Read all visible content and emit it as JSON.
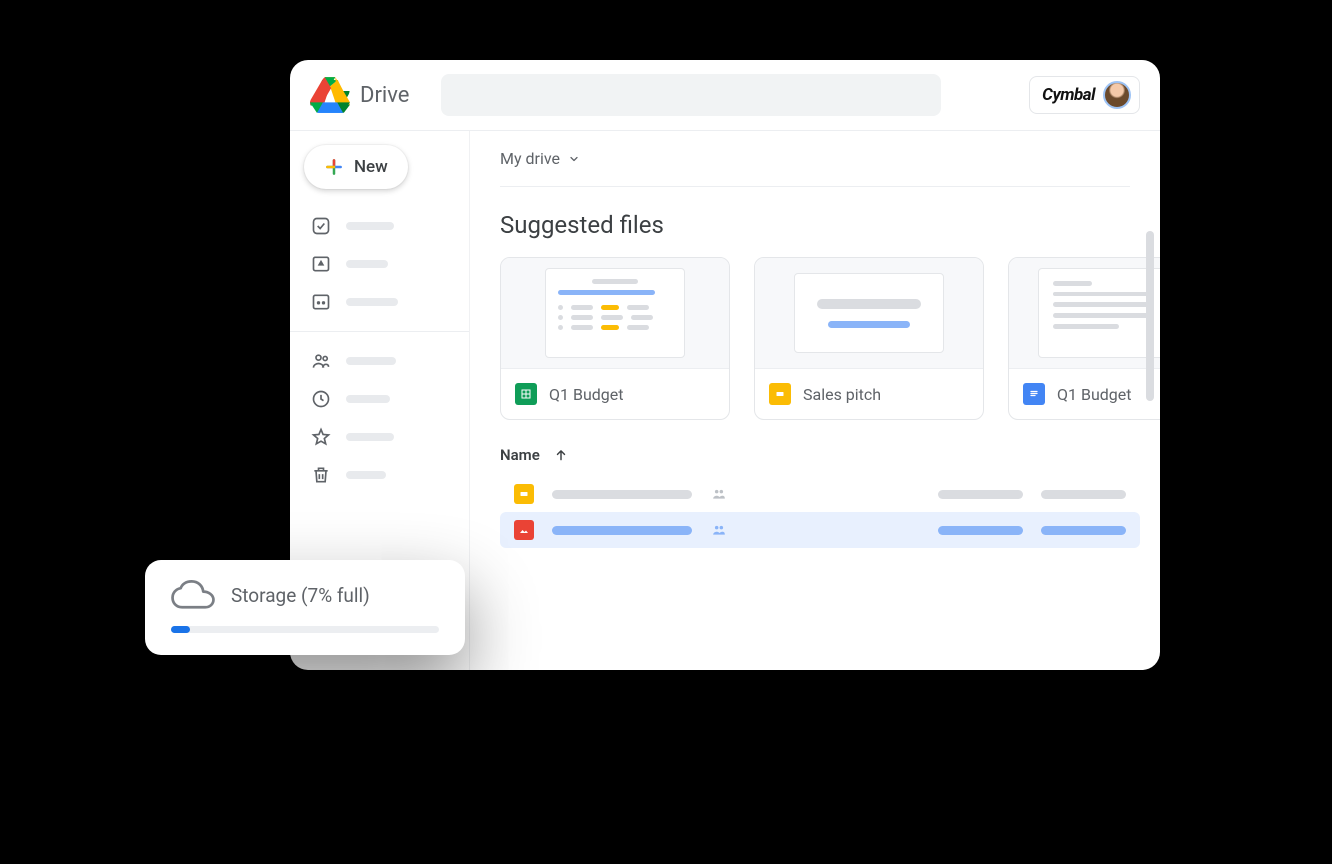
{
  "header": {
    "app_title": "Drive",
    "brand_label": "Cymbal"
  },
  "sidebar": {
    "new_label": "New"
  },
  "breadcrumb": {
    "label": "My drive"
  },
  "section": {
    "suggested_title": "Suggested files"
  },
  "cards": [
    {
      "type": "sheets",
      "name": "Q1 Budget"
    },
    {
      "type": "slides",
      "name": "Sales pitch"
    },
    {
      "type": "docs",
      "name": "Q1 Budget"
    }
  ],
  "list": {
    "header_name": "Name",
    "rows": [
      {
        "icon": "slides",
        "selected": false
      },
      {
        "icon": "image",
        "selected": true
      }
    ]
  },
  "storage": {
    "label": "Storage (7% full)",
    "percent": 7
  }
}
